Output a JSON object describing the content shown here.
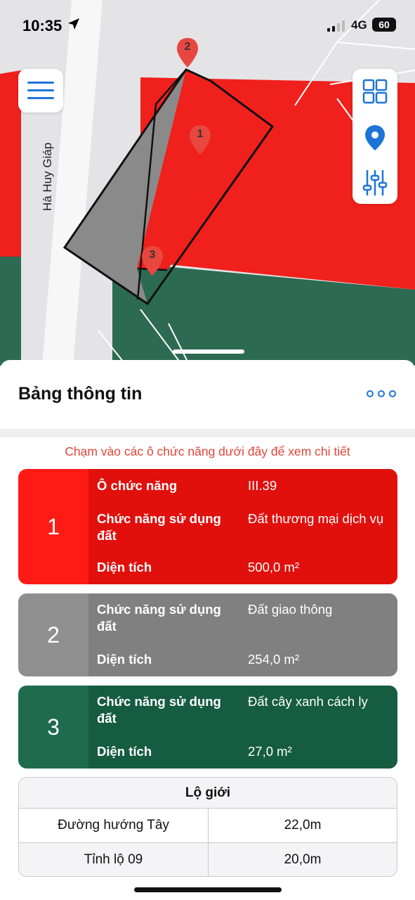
{
  "status_bar": {
    "time": "10:35",
    "network": "4G",
    "battery": "60"
  },
  "map": {
    "road_label": "Hà Huy Giáp",
    "colors": {
      "commercial": "#f0201c",
      "transport": "#808080",
      "green_buffer": "#2c6a52",
      "base": "#e4e4e6"
    },
    "markers": [
      {
        "label": "2"
      },
      {
        "label": "1"
      },
      {
        "label": "3"
      }
    ],
    "controls": {
      "menu": "menu-icon",
      "layers": "grid-icon",
      "location": "location-pin-icon",
      "filters": "sliders-icon"
    }
  },
  "sheet": {
    "title": "Bảng thông tin",
    "hint": "Chạm vào các ô chức năng dưới đây để xem chi tiết",
    "cards": [
      {
        "number": "1",
        "rows": [
          {
            "key": "Ô chức năng",
            "value": "III.39"
          },
          {
            "key": "Chức năng sử dụng đất",
            "value": "Đất thương mại dịch vụ"
          },
          {
            "key": "Diện tích",
            "value": "500,0 m²"
          }
        ]
      },
      {
        "number": "2",
        "rows": [
          {
            "key": "Chức năng sử dụng đất",
            "value": "Đất giao thông"
          },
          {
            "key": "Diện tích",
            "value": "254,0 m²"
          }
        ]
      },
      {
        "number": "3",
        "rows": [
          {
            "key": "Chức năng sử dụng đất",
            "value": "Đất cây xanh cách ly"
          },
          {
            "key": "Diện tích",
            "value": "27,0 m²"
          }
        ]
      }
    ],
    "table": {
      "header": "Lộ giới",
      "rows": [
        {
          "name": "Đường hướng Tây",
          "value": "22,0m"
        },
        {
          "name": "Tỉnh lộ 09",
          "value": "20,0m"
        }
      ]
    }
  }
}
